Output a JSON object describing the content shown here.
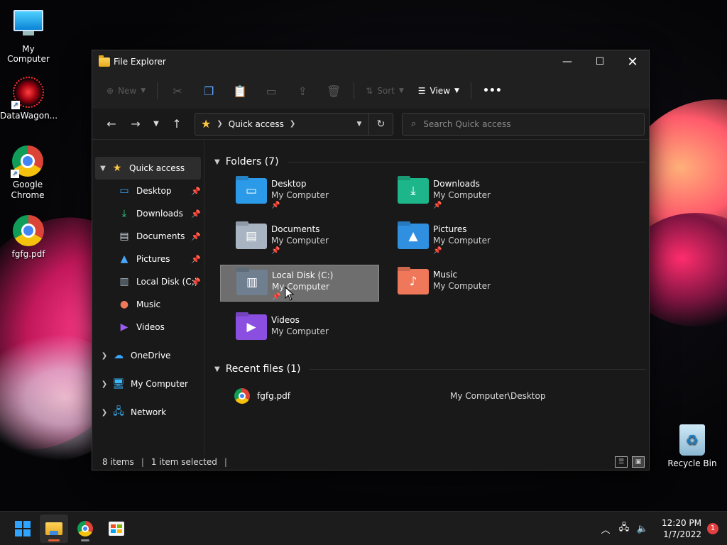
{
  "desktop": {
    "icons": [
      {
        "label": "My Computer"
      },
      {
        "label": "DataWagon..."
      },
      {
        "label": "Google Chrome"
      },
      {
        "label": "fgfg.pdf"
      },
      {
        "label": "Recycle Bin"
      }
    ]
  },
  "window": {
    "title": "File Explorer",
    "controls": {
      "minimize": "—",
      "maximize": "☐",
      "close": "✕"
    }
  },
  "toolbar": {
    "new_label": "New",
    "sort_label": "Sort",
    "view_label": "View",
    "more_label": "•••"
  },
  "navbar": {
    "address_crumb": "Quick access",
    "search_placeholder": "Search Quick access"
  },
  "sidebar": {
    "items": [
      {
        "label": "Quick access",
        "icon": "star-icon"
      },
      {
        "label": "Desktop",
        "icon": "desktop-icon"
      },
      {
        "label": "Downloads",
        "icon": "download-icon"
      },
      {
        "label": "Documents",
        "icon": "document-icon"
      },
      {
        "label": "Pictures",
        "icon": "picture-icon"
      },
      {
        "label": "Local Disk (C:)",
        "icon": "drive-icon"
      },
      {
        "label": "Music",
        "icon": "music-icon"
      },
      {
        "label": "Videos",
        "icon": "video-icon"
      },
      {
        "label": "OneDrive",
        "icon": "cloud-icon"
      },
      {
        "label": "My Computer",
        "icon": "computer-icon"
      },
      {
        "label": "Network",
        "icon": "network-icon"
      }
    ]
  },
  "content": {
    "folders_header": "Folders (7)",
    "folders": [
      {
        "name": "Desktop",
        "sub": "My Computer",
        "pinned": true,
        "color": "#2b9ae8"
      },
      {
        "name": "Downloads",
        "sub": "My Computer",
        "pinned": true,
        "color": "#1db58a"
      },
      {
        "name": "Documents",
        "sub": "My Computer",
        "pinned": true,
        "color": "#a9b4c2"
      },
      {
        "name": "Pictures",
        "sub": "My Computer",
        "pinned": true,
        "color": "#2f8fe0"
      },
      {
        "name": "Local Disk (C:)",
        "sub": "My Computer",
        "pinned": true,
        "color": "#6f7f90"
      },
      {
        "name": "Music",
        "sub": "My Computer",
        "pinned": false,
        "color": "#f0785a"
      },
      {
        "name": "Videos",
        "sub": "My Computer",
        "pinned": false,
        "color": "#8a4fe0"
      }
    ],
    "recent_header": "Recent files (1)",
    "recent": [
      {
        "name": "fgfg.pdf",
        "path": "My Computer\\Desktop"
      }
    ]
  },
  "status": {
    "items": "8 items",
    "selected": "1 item selected"
  },
  "taskbar": {
    "time": "12:20 PM",
    "date": "1/7/2022",
    "notifications": "1"
  }
}
